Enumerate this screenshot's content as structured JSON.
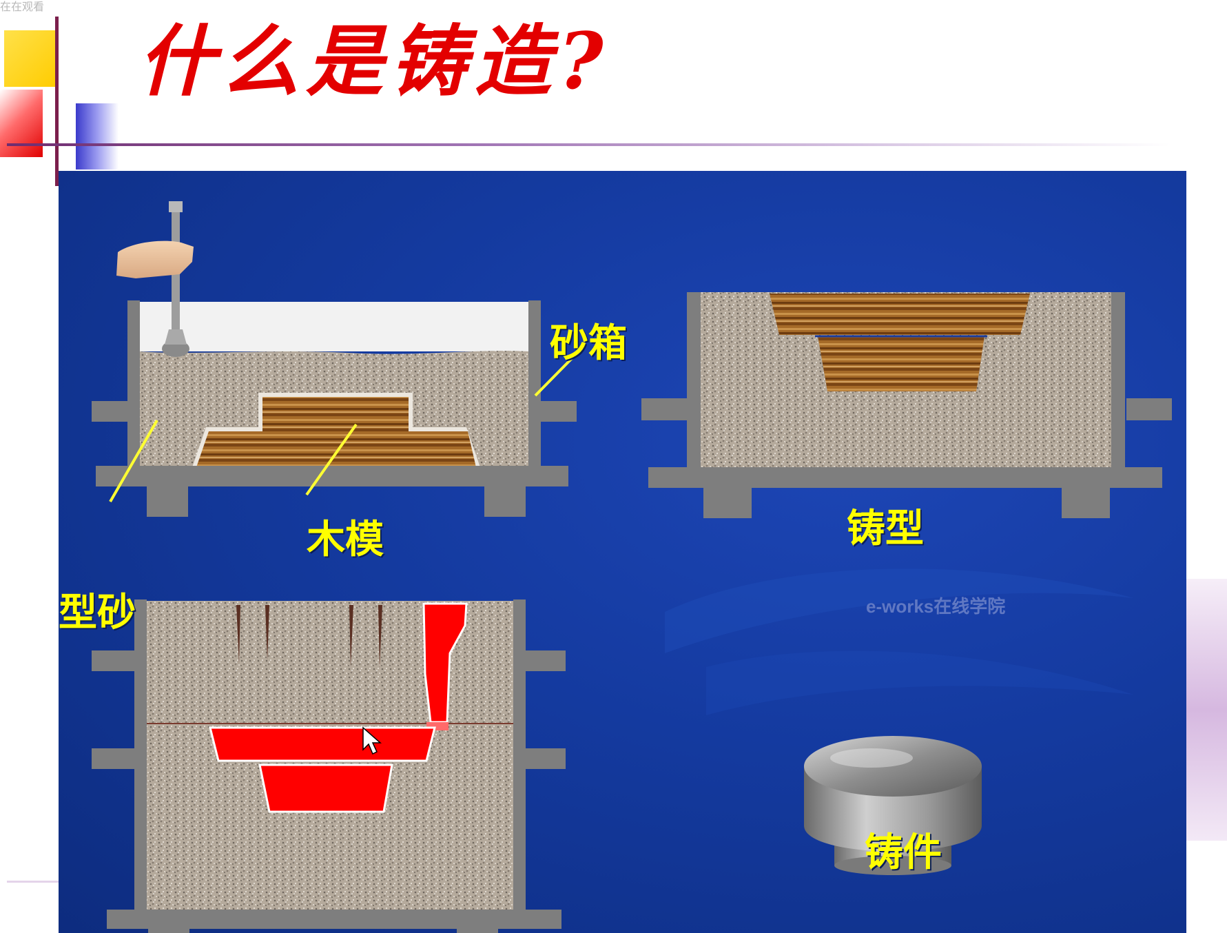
{
  "caption": "在在观看",
  "title": "什么是铸造?",
  "labels": {
    "flask": "砂箱",
    "pattern": "木模",
    "mold": "铸型",
    "molding_sand": "型砂",
    "casting": "铸件"
  },
  "watermark": "e-works在线学院",
  "colors": {
    "title": "#e30000",
    "panel": "#143a9f",
    "label": "#ffff00",
    "metal": "#ff0000",
    "sand": "#b5aa9c",
    "wood": "#a56a28",
    "frame": "#7e7e7e"
  }
}
